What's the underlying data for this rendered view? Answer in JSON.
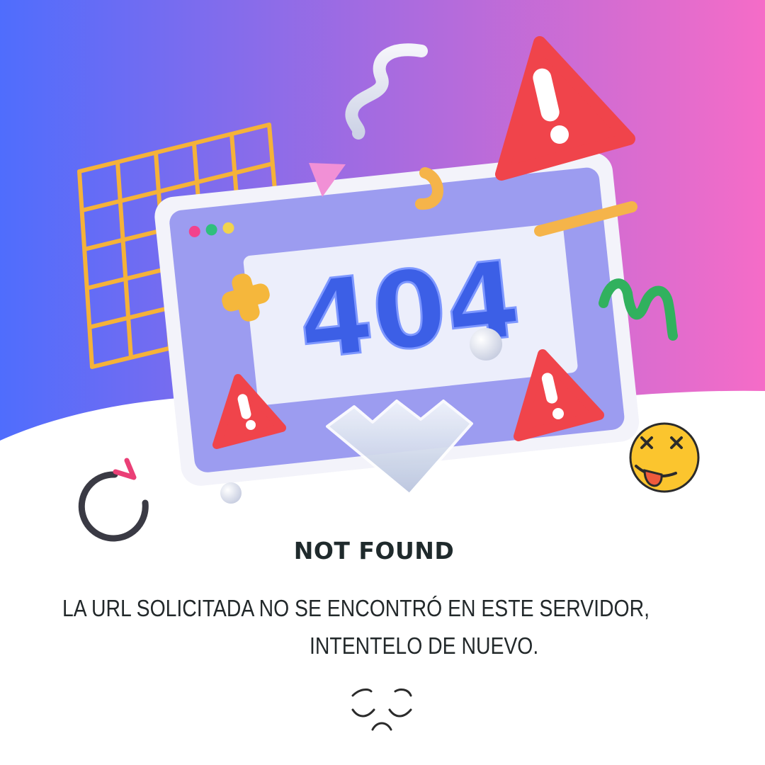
{
  "error_code": "404",
  "title": "NOT FOUND",
  "message": {
    "line1": "LA URL SOLICITADA NO SE ENCONTRÓ EN ESTE SERVIDOR,",
    "line2": "INTENTELO DE NUEVO."
  },
  "icons": {
    "reload": "reload-icon",
    "dizzy_face": "dizzy-face-emoji",
    "sad_face": "sad-face-icon",
    "warning": "warning-icon"
  },
  "colors": {
    "gradient_left": "#4f6dfd",
    "gradient_mid": "#a66be0",
    "gradient_right": "#f56cc7",
    "text_dark": "#22282a",
    "error_blue": "#3c5fe6",
    "warning_red": "#f0444b"
  }
}
